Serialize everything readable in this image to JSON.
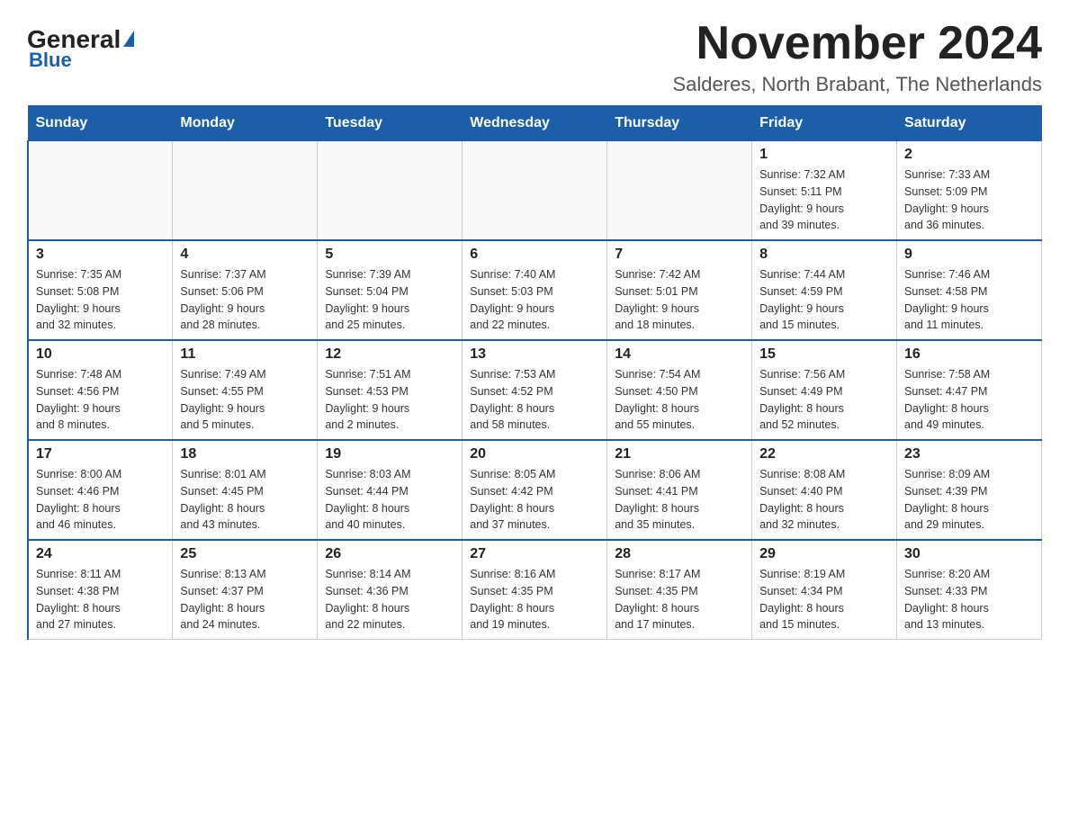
{
  "logo": {
    "general": "General",
    "blue": "Blue",
    "triangle": "▶"
  },
  "header": {
    "month_year": "November 2024",
    "location": "Salderes, North Brabant, The Netherlands"
  },
  "weekdays": [
    "Sunday",
    "Monday",
    "Tuesday",
    "Wednesday",
    "Thursday",
    "Friday",
    "Saturday"
  ],
  "rows": [
    {
      "cells": [
        {
          "day": "",
          "info": ""
        },
        {
          "day": "",
          "info": ""
        },
        {
          "day": "",
          "info": ""
        },
        {
          "day": "",
          "info": ""
        },
        {
          "day": "",
          "info": ""
        },
        {
          "day": "1",
          "info": "Sunrise: 7:32 AM\nSunset: 5:11 PM\nDaylight: 9 hours\nand 39 minutes."
        },
        {
          "day": "2",
          "info": "Sunrise: 7:33 AM\nSunset: 5:09 PM\nDaylight: 9 hours\nand 36 minutes."
        }
      ]
    },
    {
      "cells": [
        {
          "day": "3",
          "info": "Sunrise: 7:35 AM\nSunset: 5:08 PM\nDaylight: 9 hours\nand 32 minutes."
        },
        {
          "day": "4",
          "info": "Sunrise: 7:37 AM\nSunset: 5:06 PM\nDaylight: 9 hours\nand 28 minutes."
        },
        {
          "day": "5",
          "info": "Sunrise: 7:39 AM\nSunset: 5:04 PM\nDaylight: 9 hours\nand 25 minutes."
        },
        {
          "day": "6",
          "info": "Sunrise: 7:40 AM\nSunset: 5:03 PM\nDaylight: 9 hours\nand 22 minutes."
        },
        {
          "day": "7",
          "info": "Sunrise: 7:42 AM\nSunset: 5:01 PM\nDaylight: 9 hours\nand 18 minutes."
        },
        {
          "day": "8",
          "info": "Sunrise: 7:44 AM\nSunset: 4:59 PM\nDaylight: 9 hours\nand 15 minutes."
        },
        {
          "day": "9",
          "info": "Sunrise: 7:46 AM\nSunset: 4:58 PM\nDaylight: 9 hours\nand 11 minutes."
        }
      ]
    },
    {
      "cells": [
        {
          "day": "10",
          "info": "Sunrise: 7:48 AM\nSunset: 4:56 PM\nDaylight: 9 hours\nand 8 minutes."
        },
        {
          "day": "11",
          "info": "Sunrise: 7:49 AM\nSunset: 4:55 PM\nDaylight: 9 hours\nand 5 minutes."
        },
        {
          "day": "12",
          "info": "Sunrise: 7:51 AM\nSunset: 4:53 PM\nDaylight: 9 hours\nand 2 minutes."
        },
        {
          "day": "13",
          "info": "Sunrise: 7:53 AM\nSunset: 4:52 PM\nDaylight: 8 hours\nand 58 minutes."
        },
        {
          "day": "14",
          "info": "Sunrise: 7:54 AM\nSunset: 4:50 PM\nDaylight: 8 hours\nand 55 minutes."
        },
        {
          "day": "15",
          "info": "Sunrise: 7:56 AM\nSunset: 4:49 PM\nDaylight: 8 hours\nand 52 minutes."
        },
        {
          "day": "16",
          "info": "Sunrise: 7:58 AM\nSunset: 4:47 PM\nDaylight: 8 hours\nand 49 minutes."
        }
      ]
    },
    {
      "cells": [
        {
          "day": "17",
          "info": "Sunrise: 8:00 AM\nSunset: 4:46 PM\nDaylight: 8 hours\nand 46 minutes."
        },
        {
          "day": "18",
          "info": "Sunrise: 8:01 AM\nSunset: 4:45 PM\nDaylight: 8 hours\nand 43 minutes."
        },
        {
          "day": "19",
          "info": "Sunrise: 8:03 AM\nSunset: 4:44 PM\nDaylight: 8 hours\nand 40 minutes."
        },
        {
          "day": "20",
          "info": "Sunrise: 8:05 AM\nSunset: 4:42 PM\nDaylight: 8 hours\nand 37 minutes."
        },
        {
          "day": "21",
          "info": "Sunrise: 8:06 AM\nSunset: 4:41 PM\nDaylight: 8 hours\nand 35 minutes."
        },
        {
          "day": "22",
          "info": "Sunrise: 8:08 AM\nSunset: 4:40 PM\nDaylight: 8 hours\nand 32 minutes."
        },
        {
          "day": "23",
          "info": "Sunrise: 8:09 AM\nSunset: 4:39 PM\nDaylight: 8 hours\nand 29 minutes."
        }
      ]
    },
    {
      "cells": [
        {
          "day": "24",
          "info": "Sunrise: 8:11 AM\nSunset: 4:38 PM\nDaylight: 8 hours\nand 27 minutes."
        },
        {
          "day": "25",
          "info": "Sunrise: 8:13 AM\nSunset: 4:37 PM\nDaylight: 8 hours\nand 24 minutes."
        },
        {
          "day": "26",
          "info": "Sunrise: 8:14 AM\nSunset: 4:36 PM\nDaylight: 8 hours\nand 22 minutes."
        },
        {
          "day": "27",
          "info": "Sunrise: 8:16 AM\nSunset: 4:35 PM\nDaylight: 8 hours\nand 19 minutes."
        },
        {
          "day": "28",
          "info": "Sunrise: 8:17 AM\nSunset: 4:35 PM\nDaylight: 8 hours\nand 17 minutes."
        },
        {
          "day": "29",
          "info": "Sunrise: 8:19 AM\nSunset: 4:34 PM\nDaylight: 8 hours\nand 15 minutes."
        },
        {
          "day": "30",
          "info": "Sunrise: 8:20 AM\nSunset: 4:33 PM\nDaylight: 8 hours\nand 13 minutes."
        }
      ]
    }
  ]
}
